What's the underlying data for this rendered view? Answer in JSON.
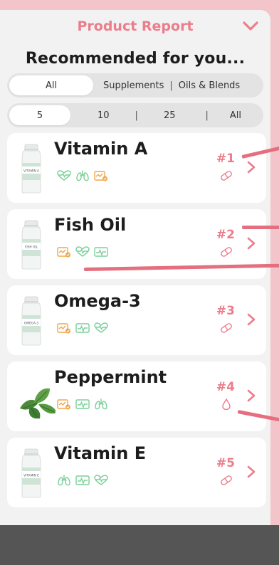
{
  "header": {
    "title": "Product Report",
    "collapse_icon": "chevron-down-icon"
  },
  "section_title": "Recommended for you...",
  "category_filter": {
    "options": [
      "All",
      "Supplements",
      "Oils & Blends"
    ],
    "selected": "All"
  },
  "count_filter": {
    "options": [
      "5",
      "10",
      "25",
      "All"
    ],
    "selected": "5"
  },
  "products": [
    {
      "name": "Vitamin A",
      "rank": "#1",
      "label": "VITAMIN A",
      "form": "capsule-icon",
      "tags": [
        "heart-icon",
        "lungs-icon",
        "check-icon"
      ]
    },
    {
      "name": "Fish Oil",
      "rank": "#2",
      "label": "FISH OIL",
      "form": "capsule-icon",
      "tags": [
        "check-icon",
        "heart-icon",
        "pulse-icon"
      ]
    },
    {
      "name": "Omega-3",
      "rank": "#3",
      "label": "OMEGA-3",
      "form": "capsule-icon",
      "tags": [
        "check-icon",
        "pulse-icon",
        "heart-icon"
      ]
    },
    {
      "name": "Peppermint",
      "rank": "#4",
      "label": "",
      "form": "drop-icon",
      "tags": [
        "check-icon",
        "pulse-icon",
        "lungs-icon"
      ]
    },
    {
      "name": "Vitamin E",
      "rank": "#5",
      "label": "VITAMIN E",
      "form": "capsule-icon",
      "tags": [
        "lungs-icon",
        "pulse-icon",
        "heart-icon"
      ]
    }
  ],
  "colors": {
    "accent": "#ec7d8c",
    "tag_green": "#7ccf9a",
    "tag_orange": "#f0a64a",
    "background": "#f4c4cb",
    "panel": "#f2f2f2"
  }
}
